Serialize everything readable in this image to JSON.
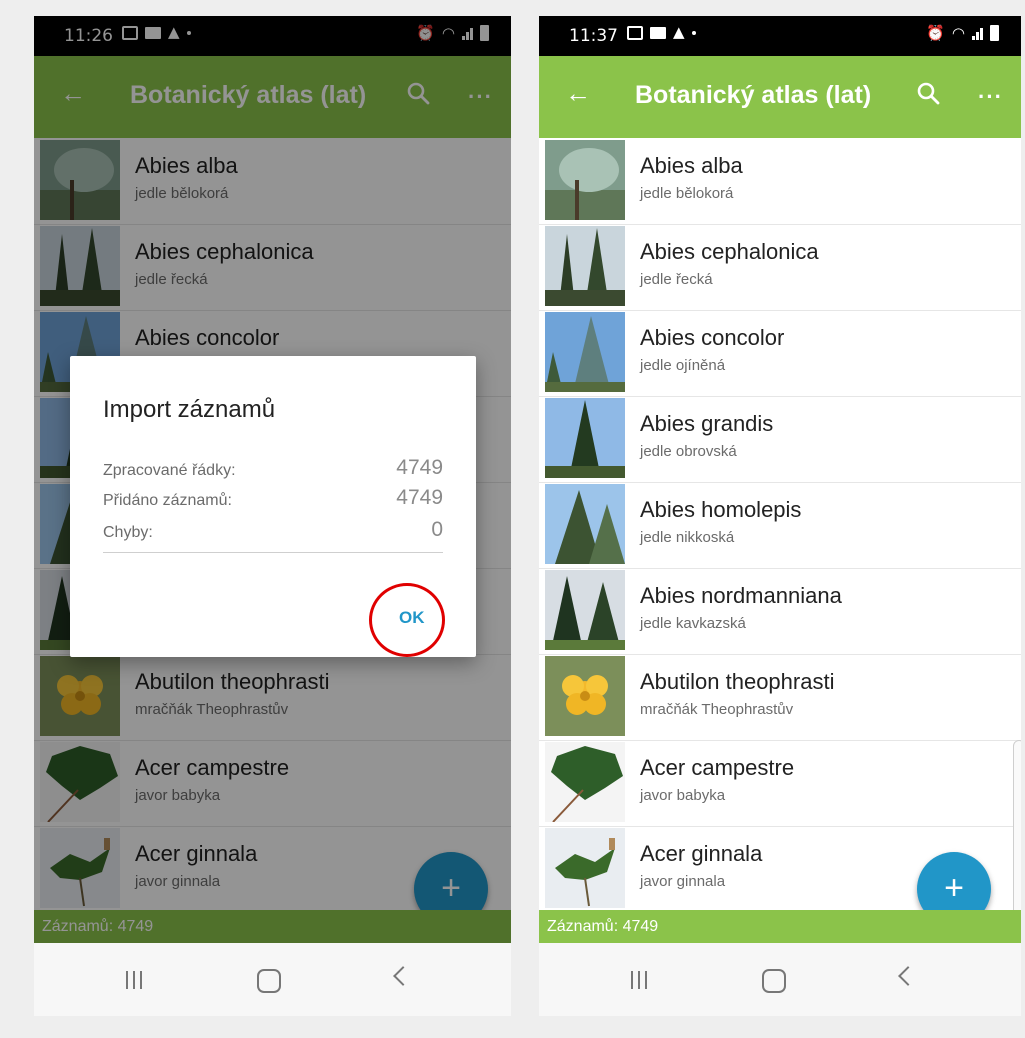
{
  "colors": {
    "app_bar": "#8bc34a",
    "fab": "#2196c8",
    "ok_button": "#2196c8",
    "highlight_circle": "#e00000"
  },
  "app": {
    "title": "Botanický atlas (lat)",
    "back_icon": "arrow-left-icon",
    "search_icon": "search-icon",
    "more_label": "···",
    "fab_label": "+",
    "footer_label": "Záznamů: 4749"
  },
  "screens": [
    {
      "status_time": "11:26"
    },
    {
      "status_time": "11:37"
    }
  ],
  "items": [
    {
      "name": "Abies alba",
      "sub": "jedle bělokorá"
    },
    {
      "name": "Abies cephalonica",
      "sub": "jedle řecká"
    },
    {
      "name": "Abies concolor",
      "sub": "jedle ojíněná"
    },
    {
      "name": "Abies grandis",
      "sub": "jedle obrovská"
    },
    {
      "name": "Abies homolepis",
      "sub": "jedle nikkoská"
    },
    {
      "name": "Abies nordmanniana",
      "sub": "jedle kavkazská"
    },
    {
      "name": "Abutilon theophrasti",
      "sub": "mračňák Theophrastův"
    },
    {
      "name": "Acer campestre",
      "sub": "javor babyka"
    },
    {
      "name": "Acer ginnala",
      "sub": "javor ginnala"
    }
  ],
  "dialog": {
    "title": "Import záznamů",
    "rows": [
      {
        "label": "Zpracované řádky:",
        "value": "4749"
      },
      {
        "label": "Přidáno záznamů:",
        "value": "4749"
      },
      {
        "label": "Chyby:",
        "value": "0"
      }
    ],
    "ok_label": "OK"
  }
}
